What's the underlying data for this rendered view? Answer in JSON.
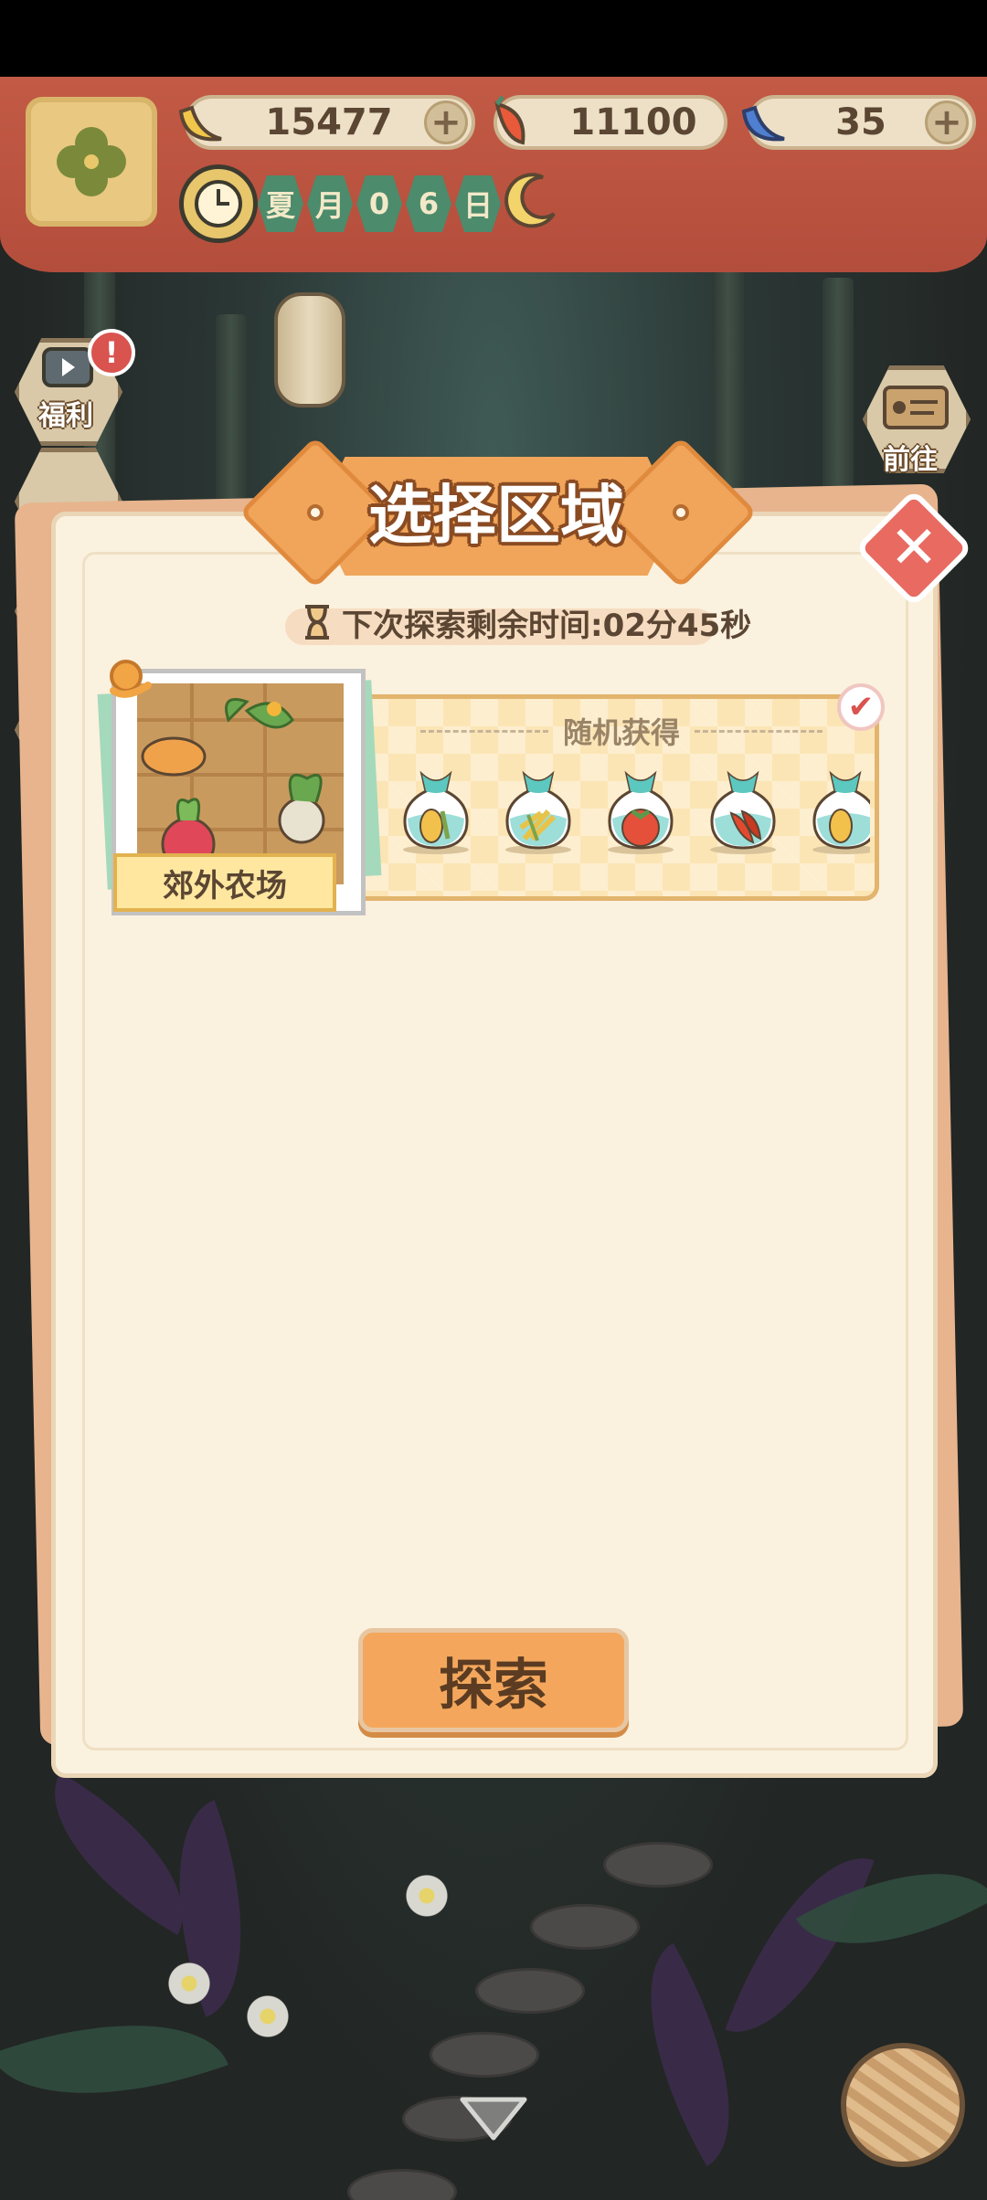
{
  "colors": {
    "topbar": "#b44e3c",
    "modal_bg": "#fbf1df",
    "title_orange": "#f0a55a",
    "close_red": "#e86a60",
    "explore_button": "#f4a75c",
    "region_label": "#ffe7a0"
  },
  "resources": [
    {
      "icon": "banana-icon",
      "value": "15477",
      "has_plus": true
    },
    {
      "icon": "chili-pepper-icon",
      "value": "11100",
      "has_plus": false
    },
    {
      "icon": "blue-banana-icon",
      "value": "35",
      "has_plus": true
    }
  ],
  "plus_symbol": "+",
  "date": {
    "cells": [
      "夏",
      "月",
      "0",
      "6",
      "日"
    ]
  },
  "side_buttons": {
    "welfare_label": "福利",
    "welfare_badge": "!",
    "goto_label": "前往"
  },
  "modal": {
    "title": "选择区域",
    "close_symbol": "✕",
    "timer_text": "下次探索剩余时间:02分45秒",
    "region": {
      "name": "郊外农场",
      "random_title": "随机获得",
      "selected": true,
      "check_symbol": "✔",
      "rewards": [
        {
          "icon": "corn-seed-bag-icon"
        },
        {
          "icon": "wheat-seed-bag-icon"
        },
        {
          "icon": "tomato-seed-bag-icon"
        },
        {
          "icon": "chili-seed-bag-icon"
        },
        {
          "icon": "corn-seed-bag-icon"
        }
      ]
    },
    "explore_label": "探索"
  }
}
